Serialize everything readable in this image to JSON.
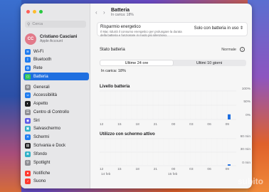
{
  "sidebar": {
    "search_placeholder": "Cerca",
    "account": {
      "initials": "CC",
      "name": "Cristiano Casciani",
      "subtitle": "Apple Account"
    },
    "items": [
      {
        "label": "Wi-Fi",
        "icon": "wifi-icon",
        "color": "#1f7cf0"
      },
      {
        "label": "Bluetooth",
        "icon": "bluetooth-icon",
        "color": "#1f7cf0"
      },
      {
        "label": "Rete",
        "icon": "network-icon",
        "color": "#1f7cf0"
      },
      {
        "label": "Batteria",
        "icon": "battery-icon",
        "color": "#34c759"
      },
      {
        "label": "Generali",
        "icon": "gear-icon",
        "color": "#8e8e93"
      },
      {
        "label": "Accessibilità",
        "icon": "accessibility-icon",
        "color": "#1f7cf0"
      },
      {
        "label": "Aspetto",
        "icon": "appearance-icon",
        "color": "#1d1d1f"
      },
      {
        "label": "Centro di Controllo",
        "icon": "control-center-icon",
        "color": "#8e8e93"
      },
      {
        "label": "Siri",
        "icon": "siri-icon",
        "color": "#5e5ce6"
      },
      {
        "label": "Salvaschermo",
        "icon": "screensaver-icon",
        "color": "#30b0c7"
      },
      {
        "label": "Schermi",
        "icon": "displays-icon",
        "color": "#1f7cf0"
      },
      {
        "label": "Scrivania e Dock",
        "icon": "dock-icon",
        "color": "#1d1d1f"
      },
      {
        "label": "Sfondo",
        "icon": "wallpaper-icon",
        "color": "#30b0c7"
      },
      {
        "label": "Spotlight",
        "icon": "spotlight-icon",
        "color": "#8e8e93"
      },
      {
        "label": "Notifiche",
        "icon": "notifications-icon",
        "color": "#ff3b30"
      },
      {
        "label": "Suono",
        "icon": "sound-icon",
        "color": "#ff3b30"
      }
    ],
    "active_label": "Batteria"
  },
  "header": {
    "title": "Batteria",
    "subtitle": "In carica: 18%"
  },
  "energy": {
    "label": "Risparmio energetico",
    "description": "Il Mac riduirà il consumo energetico per prolungare la durata della batteria e funzionare in modo più silenzioso.",
    "value": "Solo con batteria in uso"
  },
  "battery_state": {
    "label": "Stato batteria",
    "value": "Normale"
  },
  "tabs": [
    "Ultime 24 ore",
    "Ultimi 10 giorni"
  ],
  "active_tab": "Ultime 24 ore",
  "charge_status": "In carica: 18%",
  "level_chart": {
    "title": "Livello batteria",
    "y_ticks": [
      "100%",
      "50%",
      "0%"
    ]
  },
  "screen_chart": {
    "title": "Utilizzo con schermo attivo",
    "y_ticks": [
      "60 min",
      "30 min",
      "0 min"
    ]
  },
  "x_ticks": [
    "12",
    "15",
    "18",
    "21",
    "00",
    "03",
    "06",
    "09"
  ],
  "x_dates": [
    "14 feb",
    "15 feb"
  ],
  "watermark": "subito",
  "colors": {
    "accent": "#1f6fe0",
    "battery_green": "#34c759",
    "bar": "#1f6fe0"
  },
  "chart_data": [
    {
      "type": "bar",
      "title": "Livello batteria",
      "categories": [
        "12",
        "15",
        "18",
        "21",
        "00",
        "03",
        "06",
        "09"
      ],
      "values": [
        0,
        0,
        0,
        0,
        0,
        0,
        0,
        18
      ],
      "ylim": [
        0,
        100
      ],
      "ylabel": "",
      "xlabel": ""
    },
    {
      "type": "bar",
      "title": "Utilizzo con schermo attivo",
      "categories": [
        "12",
        "15",
        "18",
        "21",
        "00",
        "03",
        "06",
        "09"
      ],
      "values": [
        0,
        0,
        0,
        0,
        0,
        0,
        0,
        3
      ],
      "ylim": [
        0,
        60
      ],
      "ylabel": "",
      "xlabel": ""
    }
  ]
}
